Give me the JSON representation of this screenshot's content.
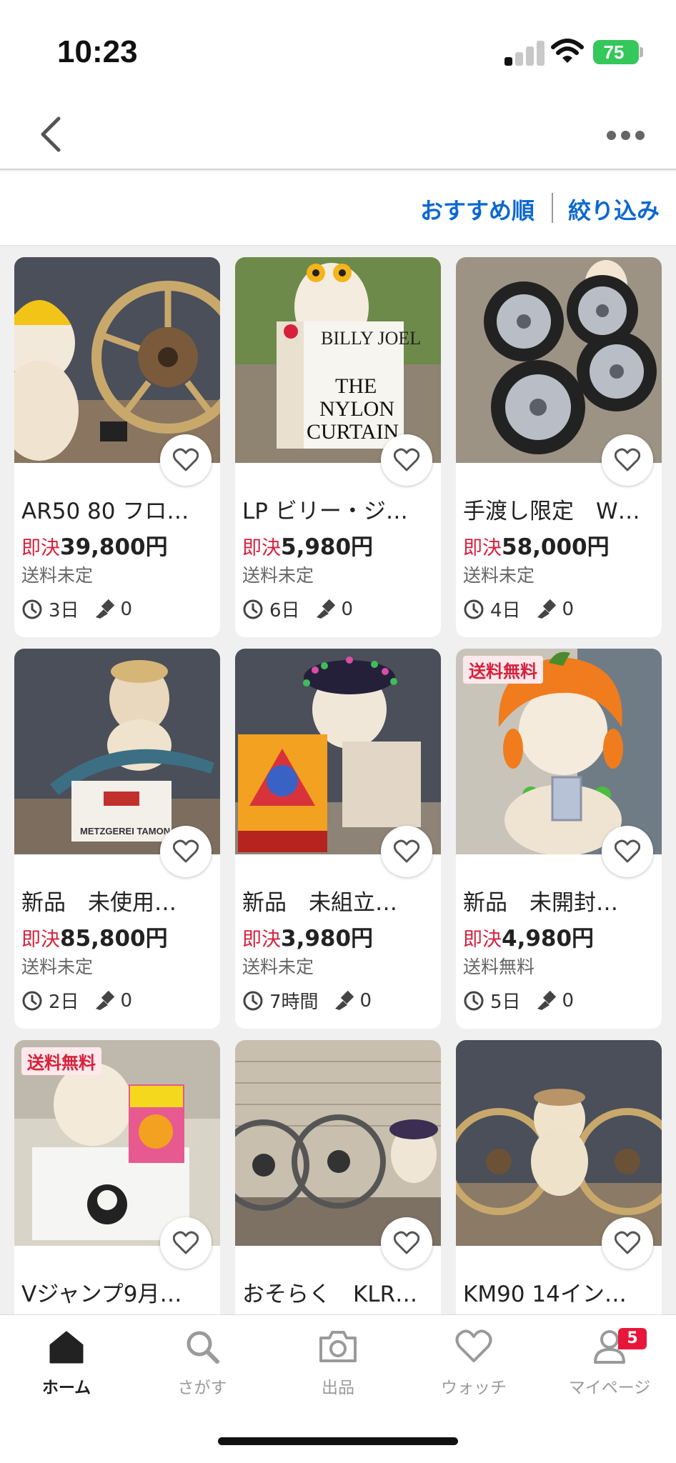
{
  "status_bar": {
    "time": "10:23",
    "battery": "75"
  },
  "header": {
    "back_icon": "chevron-left-icon",
    "more_icon": "ellipsis-icon"
  },
  "sort_bar": {
    "sort_label": "おすすめ順",
    "filter_label": "絞り込み"
  },
  "labels": {
    "price_prefix": "即決"
  },
  "items": [
    {
      "title": "AR50 80 フロ…",
      "price": "39,800円",
      "shipping": "送料未定",
      "time_left": "3日",
      "bids": "0",
      "badge": ""
    },
    {
      "title": "LP ビリー・ジ…",
      "price": "5,980円",
      "shipping": "送料未定",
      "time_left": "6日",
      "bids": "0",
      "badge": ""
    },
    {
      "title": "手渡し限定　W…",
      "price": "58,000円",
      "shipping": "送料未定",
      "time_left": "4日",
      "bids": "0",
      "badge": ""
    },
    {
      "title": "新品　未使用…",
      "price": "85,800円",
      "shipping": "送料未定",
      "time_left": "2日",
      "bids": "0",
      "badge": ""
    },
    {
      "title": "新品　未組立…",
      "price": "3,980円",
      "shipping": "送料未定",
      "time_left": "7時間",
      "bids": "0",
      "badge": ""
    },
    {
      "title": "新品　未開封…",
      "price": "4,980円",
      "shipping": "送料無料",
      "time_left": "5日",
      "bids": "0",
      "badge": "送料無料"
    },
    {
      "title": "Vジャンプ9月…",
      "price": "",
      "shipping": "",
      "time_left": "",
      "bids": "",
      "badge": "送料無料"
    },
    {
      "title": "おそらく　KLR…",
      "price": "",
      "shipping": "",
      "time_left": "",
      "bids": "",
      "badge": ""
    },
    {
      "title": "KM90 14イン…",
      "price": "",
      "shipping": "",
      "time_left": "",
      "bids": "",
      "badge": ""
    }
  ],
  "image_text": {
    "lp_artist": "BILLY JOEL",
    "lp_title_1": "THE",
    "lp_title_2": "NYLON",
    "lp_title_3": "CURTAIN",
    "box_label": "METZGEREI TAMON"
  },
  "tab_bar": {
    "home": "ホーム",
    "search": "さがす",
    "sell": "出品",
    "watch": "ウォッチ",
    "mypage": "マイページ",
    "mypage_badge": "5"
  },
  "colors": {
    "accent_blue": "#0b68d1",
    "price_red": "#d6213c",
    "badge_red": "#e8163a",
    "battery_green": "#34c759"
  }
}
